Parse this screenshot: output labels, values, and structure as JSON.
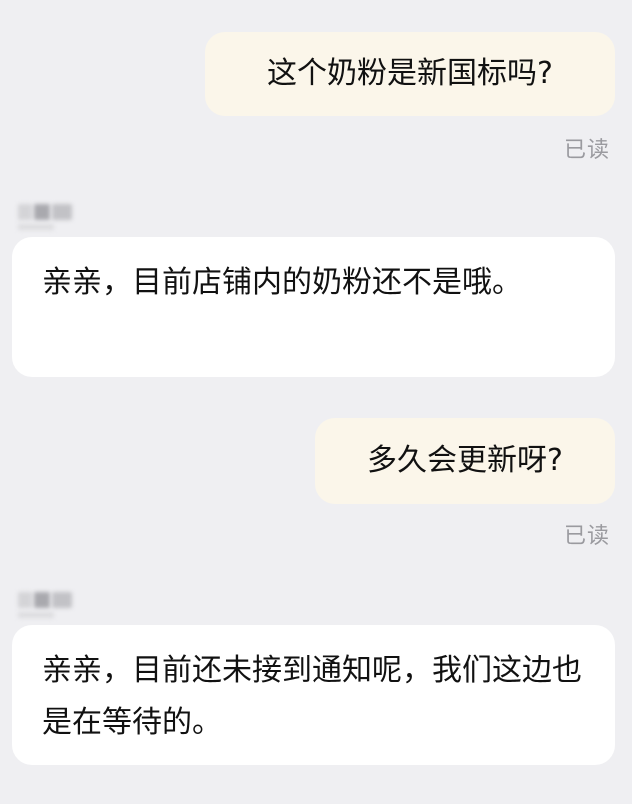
{
  "messages": [
    {
      "sender": "me",
      "text": "这个奶粉是新国标吗?",
      "status": "已读"
    },
    {
      "sender": "them",
      "name": "",
      "text": "亲亲，目前店铺内的奶粉还不是哦。"
    },
    {
      "sender": "me",
      "text": "多久会更新呀?",
      "status": "已读"
    },
    {
      "sender": "them",
      "name": "",
      "text": "亲亲，目前还未接到通知呢，我们这边也是在等待的。"
    }
  ],
  "colors": {
    "background": "#efeff2",
    "my_bubble": "#fbf6ea",
    "their_bubble": "#ffffff",
    "read_status": "#9a9a9f"
  }
}
